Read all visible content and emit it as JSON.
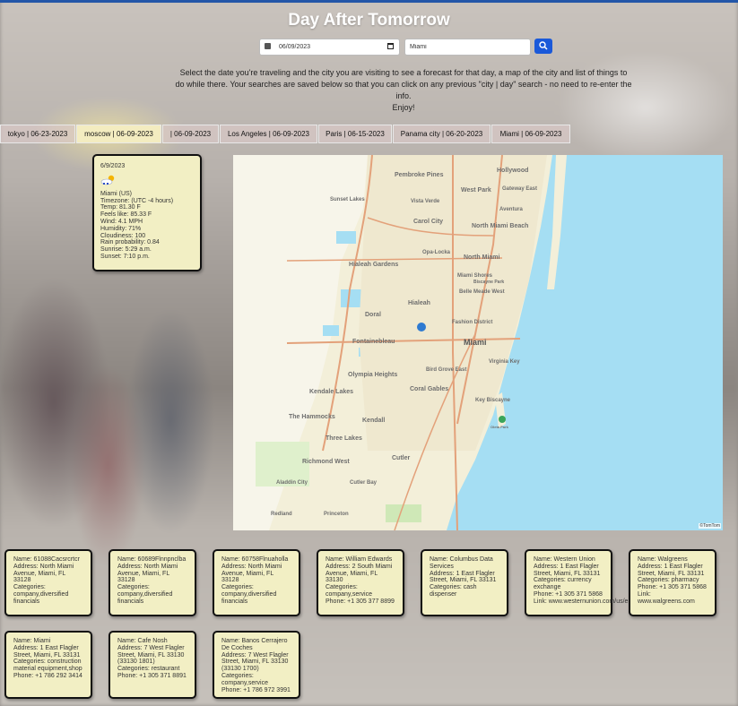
{
  "app": {
    "title": "Day After Tomorrow"
  },
  "search": {
    "date_value": "06/09/2023",
    "city_value": "Miami"
  },
  "instructions": {
    "text": "Select the date you're traveling and the city you are visiting to see a forecast for that day, a map of the city and list of things to do while there. Your searches are saved below so that you can click on any previous \"city | day\" search - no need to re-enter the info.",
    "enjoy": "Enjoy!"
  },
  "history": [
    {
      "label": "tokyo | 06-23-2023"
    },
    {
      "label": "moscow | 06-09-2023"
    },
    {
      "label": "| 06-09-2023"
    },
    {
      "label": "Los Angeles | 06-09-2023"
    },
    {
      "label": "Paris | 06-15-2023"
    },
    {
      "label": "Panama city | 06-20-2023"
    },
    {
      "label": "Miami | 06-09-2023"
    }
  ],
  "weather": {
    "date": "6/9/2023",
    "icon": "partly-cloudy-icon",
    "city": "Miami (US)",
    "timezone": "Timezone: (UTC -4 hours)",
    "temp": "Temp: 81.30 F",
    "feels": "Feels like: 85.33 F",
    "wind": "Wind: 4.1 MPH",
    "humidity": "Humidity: 71%",
    "cloudiness": "Cloudiness: 100",
    "rain": "Rain probability: 0.84",
    "sunrise": "Sunrise: 5:29 a.m.",
    "sunset": "Sunset: 7:10 p.m."
  },
  "map": {
    "credit": "©TomTom",
    "labels": [
      "Hollywood",
      "Pembroke Pines",
      "West Park",
      "Gateway East",
      "Sunset Lakes",
      "Vista Verde",
      "Aventura",
      "Carol City",
      "North Miami Beach",
      "Opa-Locka",
      "North Miami",
      "Hialeah Gardens",
      "Miami Shores",
      "Biscayne Park",
      "Belle Meade West",
      "Doral",
      "Hialeah",
      "Fashion District",
      "Fontainebleau",
      "Miami",
      "Virginia Key",
      "Olympia Heights",
      "Bird Grove East",
      "Kendale Lakes",
      "Coral Gables",
      "Key Biscayne",
      "The Hammocks",
      "Kendall",
      "Three Lakes",
      "Richmond West",
      "Cutler",
      "Aladdin City",
      "Cutler Bay",
      "Redland",
      "Princeton",
      "Oleta Park"
    ],
    "colors": {
      "water": "#a5def3",
      "land": "#f3efd9",
      "roads": "#e3a17a",
      "park": "#cfe8b7"
    }
  },
  "places": [
    {
      "name": "Name: 61088Cacsrcrtcr",
      "address": "Address: North Miami Avenue, Miami, FL 33128",
      "categories": "Categories: company,diversified financials",
      "phone": "",
      "link": ""
    },
    {
      "name": "Name: 60689Flnnpnclba",
      "address": "Address: North Miami Avenue, Miami, FL 33128",
      "categories": "Categories: company,diversified financials",
      "phone": "",
      "link": ""
    },
    {
      "name": "Name: 60758Flnuaholla",
      "address": "Address: North Miami Avenue, Miami, FL 33128",
      "categories": "Categories: company,diversified financials",
      "phone": "",
      "link": ""
    },
    {
      "name": "Name: William Edwards",
      "address": "Address: 2 South Miami Avenue, Miami, FL 33130",
      "categories": "Categories: company,service",
      "phone": "Phone: +1 305 377 8899",
      "link": ""
    },
    {
      "name": "Name: Columbus Data Services",
      "address": "Address: 1 East Flagler Street, Miami, FL 33131",
      "categories": "Categories: cash dispenser",
      "phone": "",
      "link": ""
    },
    {
      "name": "Name: Western Union",
      "address": "Address: 1 East Flagler Street, Miami, FL 33131",
      "categories": "Categories: currency exchange",
      "phone": "Phone: +1 305 371 5868",
      "link": "Link: www.westernunion.com/us/en/home.html"
    },
    {
      "name": "Name: Walgreens",
      "address": "Address: 1 East Flagler Street, Miami, FL 33131",
      "categories": "Categories: pharmacy",
      "phone": "Phone: +1 305 371 5868",
      "link": "Link: www.walgreens.com"
    },
    {
      "name": "Name: Miami",
      "address": "Address: 1 East Flagler Street, Miami, FL 33131",
      "categories": "Categories: construction material equipment,shop",
      "phone": "Phone: +1 786 292 3414",
      "link": ""
    },
    {
      "name": "Name: Cafe Nosh",
      "address": "Address: 7 West Flagler Street, Miami, FL 33130 (33130 1801)",
      "categories": "Categories: restaurant",
      "phone": "Phone: +1 305 371 8891",
      "link": ""
    },
    {
      "name": "Name: Banos Cerrajero De Coches",
      "address": "Address: 7 West Flagler Street, Miami, FL 33130 (33130 1700)",
      "categories": "Categories: company,service",
      "phone": "Phone: +1 786 972 3991",
      "link": ""
    }
  ]
}
